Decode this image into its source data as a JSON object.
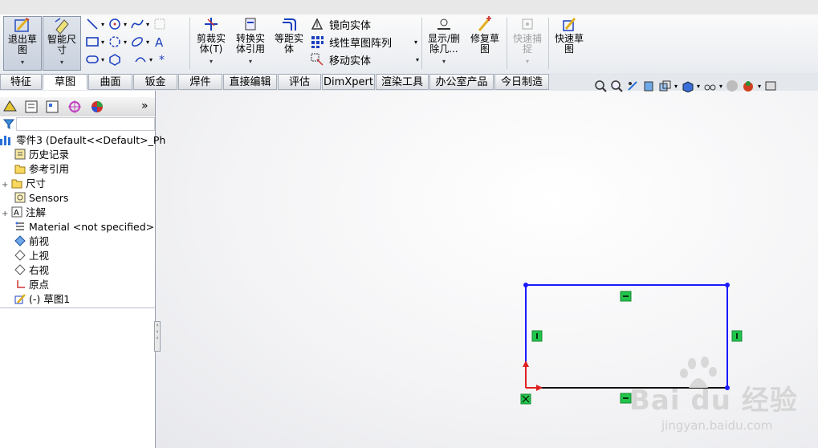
{
  "ribbon": {
    "exit_sketch": "退出草\n图",
    "smart_dimension": "智能尺\n寸",
    "trim_entities": "剪裁实\n体(T)",
    "convert_entities": "转换实\n体引用",
    "offset_entities": "等距实\n体",
    "mirror_entities": "镜向实体",
    "linear_pattern": "线性草图阵列",
    "move_entities": "移动实体",
    "display_delete": "显示/删\n除几...",
    "repair_sketch": "修复草\n图",
    "quick_snaps": "快速捕\n捉",
    "rapid_sketch": "快速草\n图"
  },
  "tabs": [
    "特征",
    "草图",
    "曲面",
    "钣金",
    "焊件",
    "直接编辑",
    "评估",
    "DimXpert",
    "渲染工具",
    "办公室产品",
    "今日制造"
  ],
  "active_tab": "草图",
  "panel": {
    "collapse_label": "»",
    "tree": [
      {
        "label": "零件3  (Default<<Default>_Ph",
        "icon": "part-icon",
        "expand": ""
      },
      {
        "label": "历史记录",
        "icon": "history-icon",
        "expand": ""
      },
      {
        "label": "参考引用",
        "icon": "folder-icon",
        "expand": ""
      },
      {
        "label": "尺寸",
        "icon": "folder-icon",
        "expand": "+"
      },
      {
        "label": "Sensors",
        "icon": "sensors-icon",
        "expand": ""
      },
      {
        "label": "注解",
        "icon": "annotation-icon",
        "expand": "+"
      },
      {
        "label": "Material <not specified>",
        "icon": "material-icon",
        "expand": ""
      },
      {
        "label": "前视",
        "icon": "plane-icon",
        "expand": ""
      },
      {
        "label": "上视",
        "icon": "plane-icon",
        "expand": ""
      },
      {
        "label": "右视",
        "icon": "plane-icon",
        "expand": ""
      },
      {
        "label": "原点",
        "icon": "origin-icon",
        "expand": ""
      },
      {
        "label": "(-) 草图1",
        "icon": "sketch-icon",
        "expand": ""
      }
    ]
  },
  "watermark": {
    "brand": "Bai du 经验",
    "url": "jingyan.baidu.com"
  },
  "colors": {
    "sketch_line": "#1a1aff",
    "relation_badge": "#21c44a",
    "accent": "#3a6fd8"
  }
}
